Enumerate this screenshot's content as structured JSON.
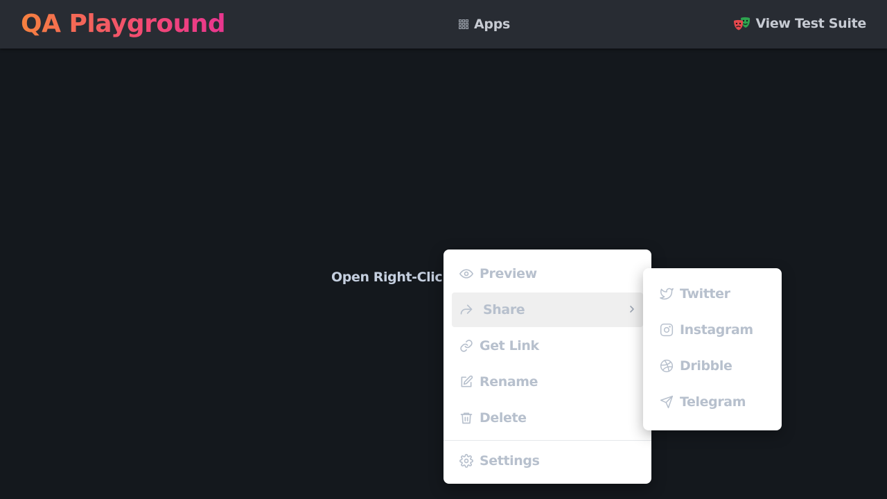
{
  "header": {
    "logo": "QA Playground",
    "apps_label": "Apps",
    "apps_icon": "grid-icon",
    "suite_label": "View Test Suite",
    "suite_icon": "theater-masks-icon"
  },
  "main": {
    "trigger_label": "Open Right-Clic"
  },
  "context_menu": {
    "items": [
      {
        "label": "Preview",
        "icon": "eye-icon"
      },
      {
        "label": "Share",
        "icon": "share-icon",
        "active": true,
        "has_submenu": true
      },
      {
        "label": "Get Link",
        "icon": "link-icon"
      },
      {
        "label": "Rename",
        "icon": "edit-icon"
      },
      {
        "label": "Delete",
        "icon": "trash-icon"
      },
      {
        "label": "Settings",
        "icon": "gear-icon"
      }
    ]
  },
  "share_submenu": {
    "items": [
      {
        "label": "Twitter",
        "icon": "twitter-icon"
      },
      {
        "label": "Instagram",
        "icon": "instagram-icon"
      },
      {
        "label": "Dribble",
        "icon": "dribbble-icon"
      },
      {
        "label": "Telegram",
        "icon": "telegram-icon"
      }
    ]
  },
  "colors": {
    "header_bg": "#282c33",
    "page_bg": "#14181d",
    "menu_text": "#b7c0cd",
    "active_item_bg": "#efefef",
    "logo_gradient_start": "#f5813f",
    "logo_gradient_end": "#e8368f"
  }
}
